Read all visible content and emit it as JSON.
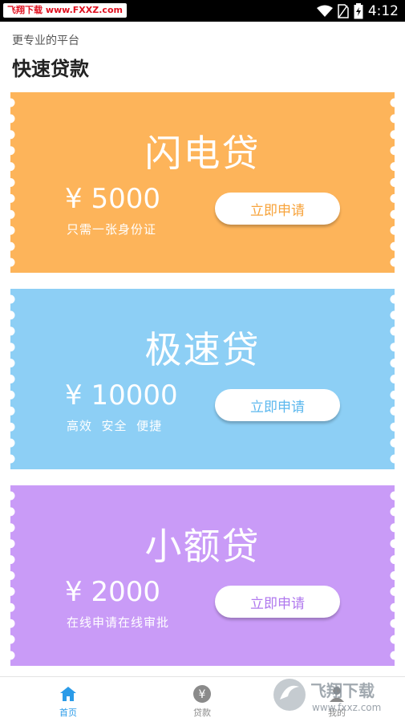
{
  "status_bar": {
    "watermark": "飞翔下载 www.FXXZ.com",
    "time": "4:12"
  },
  "header": {
    "subtitle": "更专业的平台",
    "title": "快速贷款"
  },
  "cards": [
    {
      "title": "闪电贷",
      "amount": "¥ 5000",
      "desc": "只需一张身份证",
      "button": "立即申请",
      "color": "#FDB45A",
      "accent": "#F7A33B"
    },
    {
      "title": "极速贷",
      "amount": "¥ 10000",
      "desc": "高效  安全  便捷",
      "button": "立即申请",
      "color": "#8DCFF5",
      "accent": "#5DB8EE"
    },
    {
      "title": "小额贷",
      "amount": "¥ 2000",
      "desc": "在线申请在线审批",
      "button": "立即申请",
      "color": "#C99BF7",
      "accent": "#B078EE"
    }
  ],
  "nav": {
    "items": [
      {
        "label": "首页",
        "icon": "home-icon",
        "active": true
      },
      {
        "label": "贷款",
        "icon": "yen-icon",
        "active": false
      },
      {
        "label": "我的",
        "icon": "user-icon",
        "active": false
      }
    ],
    "active_color": "#2A9BE8",
    "inactive_color": "#8a8a8a"
  },
  "logo_watermark": {
    "text": "飞翔下载",
    "url": "www.fxxz.com"
  }
}
